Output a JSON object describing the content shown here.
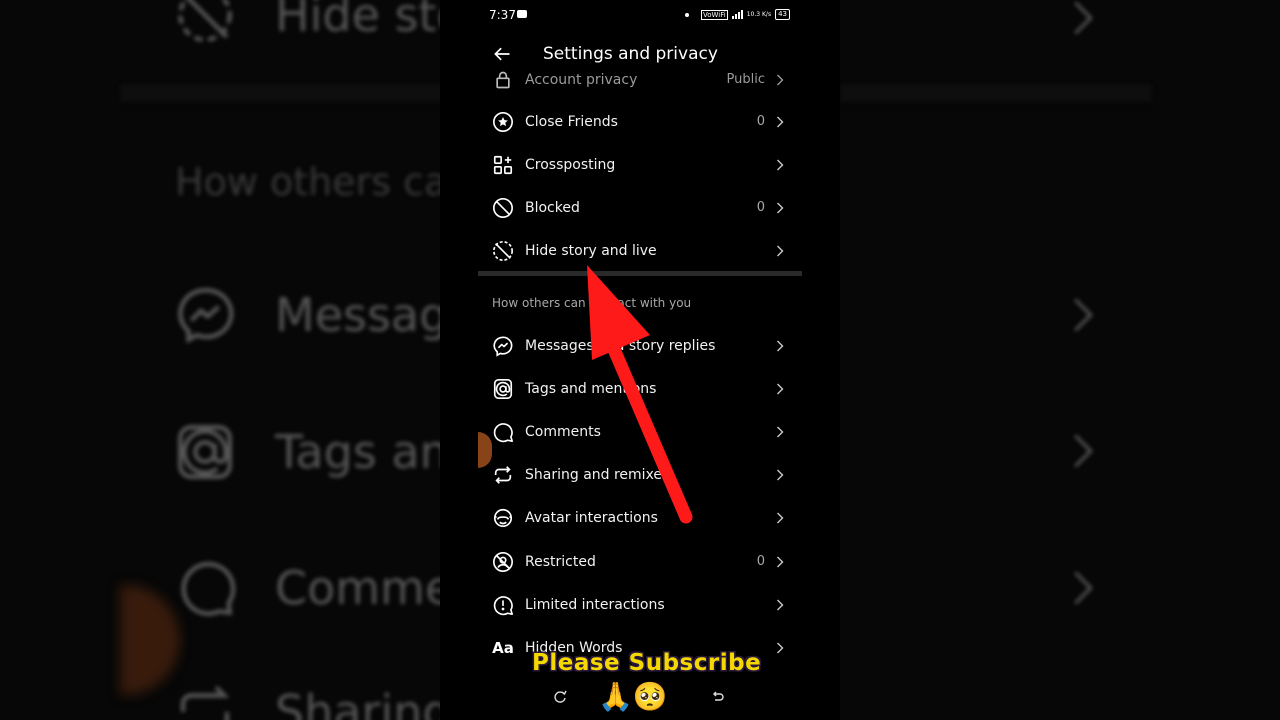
{
  "status_bar": {
    "time": "7:37",
    "net": "VoWiFi",
    "speed": "10.3 K/s",
    "battery": "43"
  },
  "header": {
    "title": "Settings and privacy",
    "back_icon": "arrow-left-icon"
  },
  "items_top": [
    {
      "label": "Account privacy",
      "count": "Public",
      "icon": "lock-icon"
    },
    {
      "label": "Close Friends",
      "count": "0",
      "icon": "star-circle-icon"
    },
    {
      "label": "Crossposting",
      "count": "",
      "icon": "grid-plus-icon"
    },
    {
      "label": "Blocked",
      "count": "0",
      "icon": "blocked-icon"
    },
    {
      "label": "Hide story and live",
      "count": "",
      "icon": "hide-story-icon"
    }
  ],
  "section_title": "How others can interact with you",
  "items_interact": [
    {
      "label": "Messages and story replies",
      "count": "",
      "icon": "messenger-icon"
    },
    {
      "label": "Tags and mentions",
      "count": "",
      "icon": "at-icon"
    },
    {
      "label": "Comments",
      "count": "",
      "icon": "comment-icon"
    },
    {
      "label": "Sharing and remixes",
      "count": "",
      "icon": "share-remix-icon"
    },
    {
      "label": "Avatar interactions",
      "count": "",
      "icon": "avatar-icon"
    },
    {
      "label": "Restricted",
      "count": "0",
      "icon": "restricted-icon"
    },
    {
      "label": "Limited interactions",
      "count": "",
      "icon": "limited-icon"
    },
    {
      "label": "Hidden Words",
      "count": "",
      "icon": "aa-icon"
    }
  ],
  "overlay": {
    "subscribe_text": "Please Subscribe",
    "emojis": "🙏🥺"
  },
  "background": {
    "left": [
      "Hide sto",
      "How others can",
      "Messag",
      "Tags an",
      "Commer",
      "Sharing"
    ],
    "colors": {
      "accent_red": "#ff1a1a",
      "subscribe_yellow": "#f5d800"
    }
  }
}
